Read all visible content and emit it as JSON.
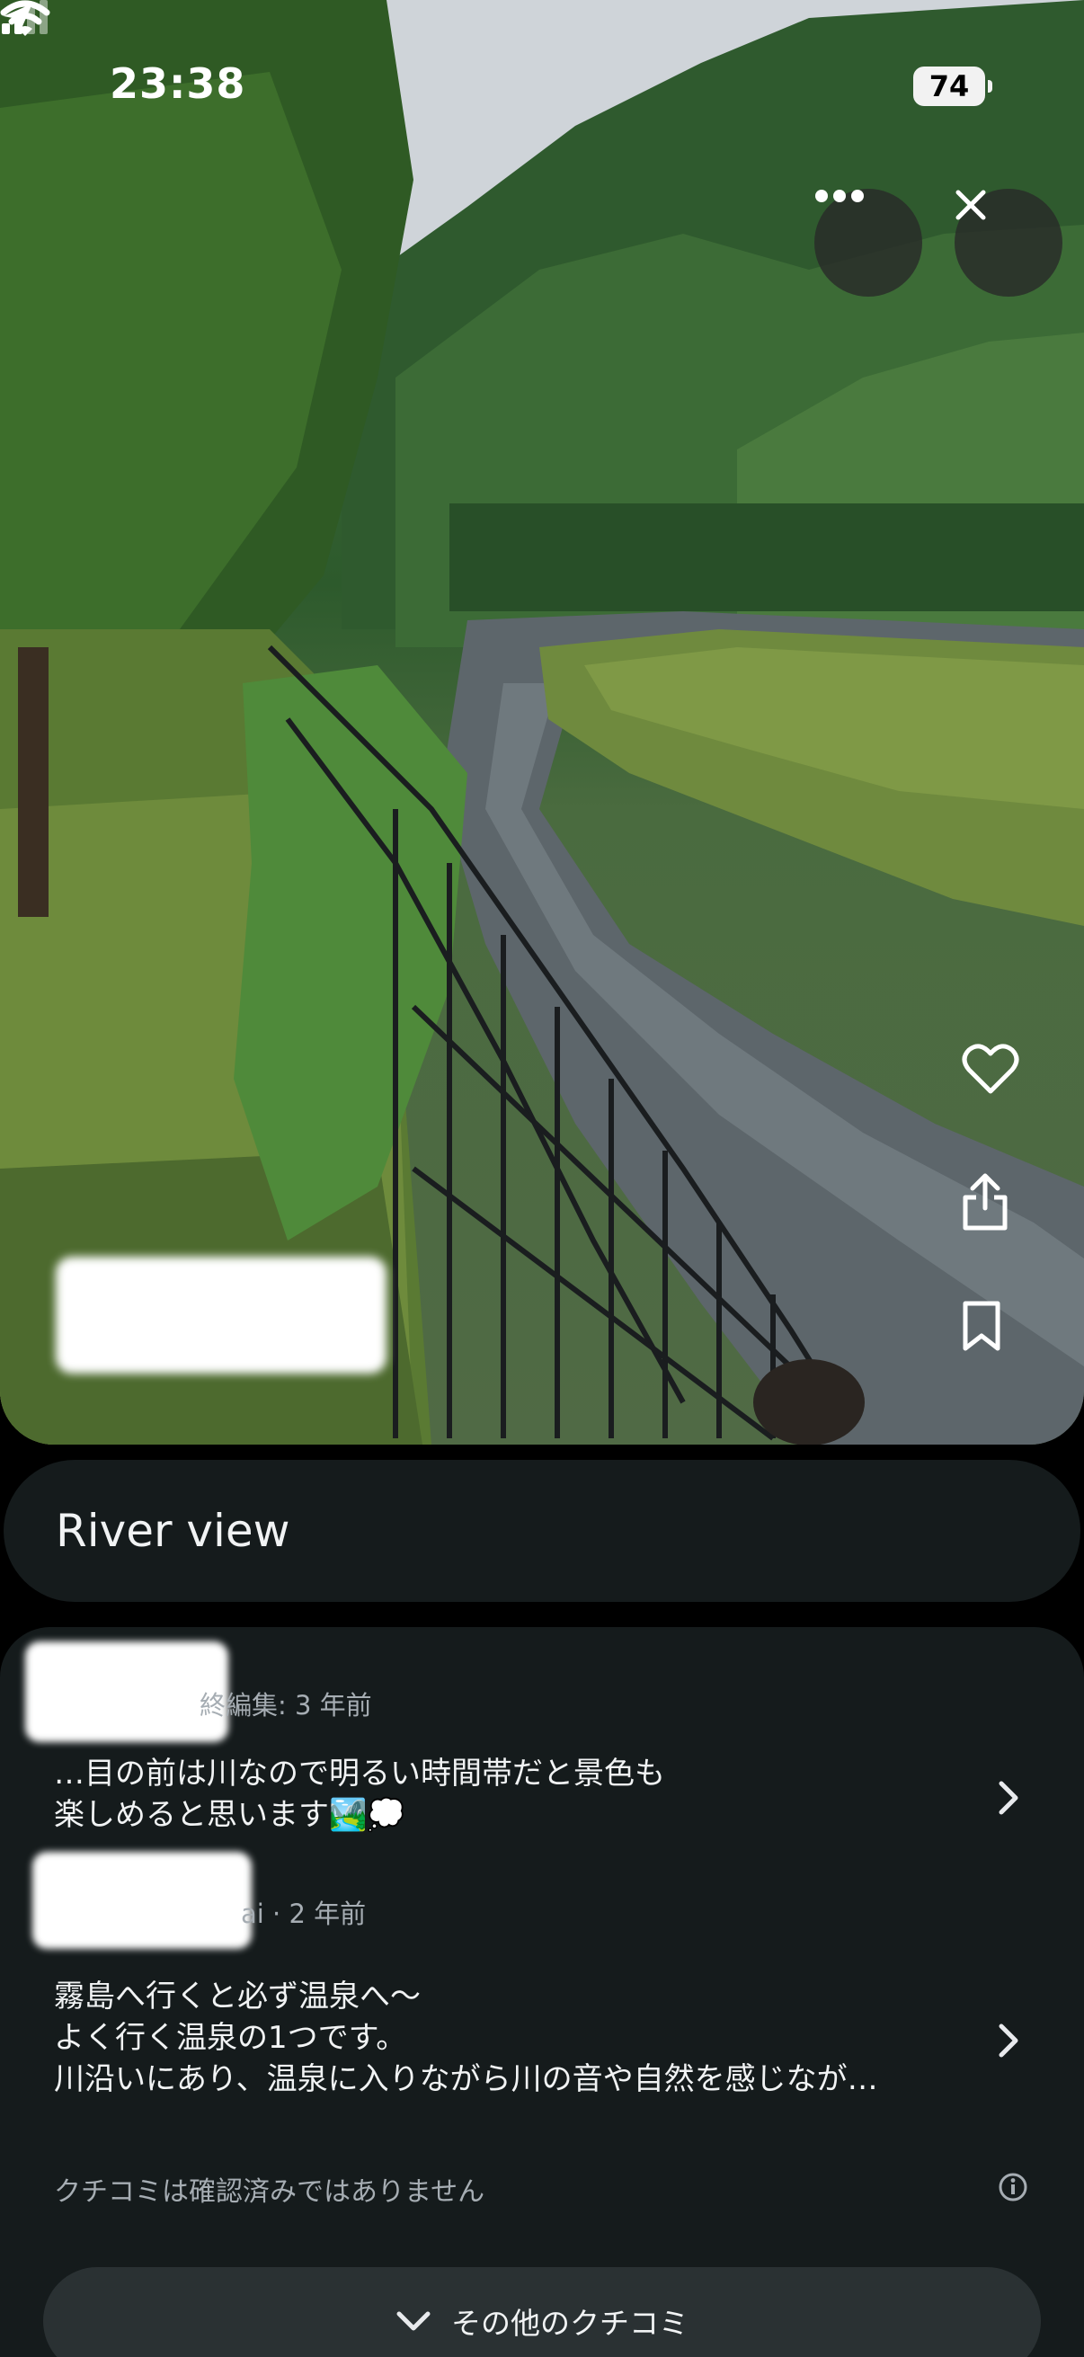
{
  "status_bar": {
    "time": "23:38",
    "battery": "74"
  },
  "photo": {
    "label": "River view"
  },
  "reviews": [
    {
      "meta": "終編集: 3 年前",
      "text": "…目の前は川なので明るい時間帯だと景色も\n楽しめると思います🏞️💭"
    },
    {
      "meta": "ai · 2 年前",
      "text": "霧島へ行くと必ず温泉へ〜\nよく行く温泉の1つです。\n川沿いにあり、温泉に入りながら川の音や自然を感じなが…"
    }
  ],
  "disclaimer": "クチコミは確認済みではありません",
  "more_reviews_label": "その他のクチコミ",
  "icons": {
    "location": "location-arrow-icon",
    "signal": "cellular-signal-icon",
    "wifi": "wifi-icon",
    "more": "more-horizontal-icon",
    "close": "close-icon",
    "heart": "heart-icon",
    "share": "share-icon",
    "bookmark": "bookmark-icon",
    "chevron": "chevron-right-icon",
    "info": "info-icon",
    "expand": "chevron-down-icon"
  }
}
